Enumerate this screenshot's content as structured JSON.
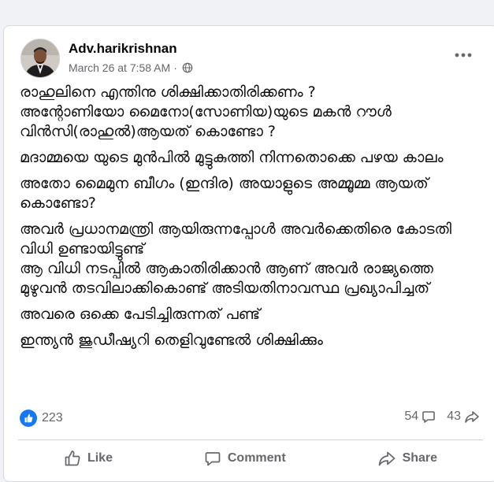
{
  "post": {
    "author": "Adv.harikrishnan",
    "date": "March 26 at 7:58 AM",
    "separator": "·",
    "paragraphs": [
      "രാഹുലിനെ എന്തിനു ശിക്ഷിക്കാതിരിക്കണം ?\nഅന്റോണിയോ മൈനോ(സോണിയ)യുടെ മകൻ റൗൾ വിൻസി(രാഹുൽ)ആയത് കൊണ്ടോ ?",
      "മദാമ്മയെ യുടെ മുൻപിൽ മുട്ടുകുത്തി നിന്നതൊക്കെ പഴയ കാലം",
      "അതോ മൈമുന ബീഗം (ഇന്ദിര) അയാളുടെ അമ്മൂമ്മ ആയത് കൊണ്ടോ?",
      "അവർ പ്രധാനമന്ത്രി ആയിരുന്നപ്പോൾ അവർക്കെതിരെ കോടതി വിധി ഉണ്ടായിട്ടുണ്ട്\nആ വിധി നടപ്പിൽ ആകാതിരിക്കാൻ ആണ് അവർ രാജ്യത്തെ മുഴുവൻ തടവിലാക്കികൊണ്ട് അടിയതിനാവസ്ഥ പ്രഖ്യാപിച്ചത്",
      "അവരെ ഒക്കെ പേടിച്ചിരുന്നത് പണ്ട്",
      "ഇന്ത്യൻ ജുഡീഷ്യറി തെളിവുണ്ടേൽ ശിക്ഷിക്കും"
    ]
  },
  "stats": {
    "reactions": "223",
    "comments": "54",
    "shares": "43"
  },
  "actions": {
    "like": "Like",
    "comment": "Comment",
    "share": "Share"
  },
  "colors": {
    "accent": "#1877f2",
    "muted": "#65676b",
    "background": "#f0f2f5"
  },
  "icons": [
    "globe-icon",
    "more-options-icon",
    "like-reaction-icon",
    "comment-icon",
    "share-icon",
    "thumbs-up-icon"
  ]
}
